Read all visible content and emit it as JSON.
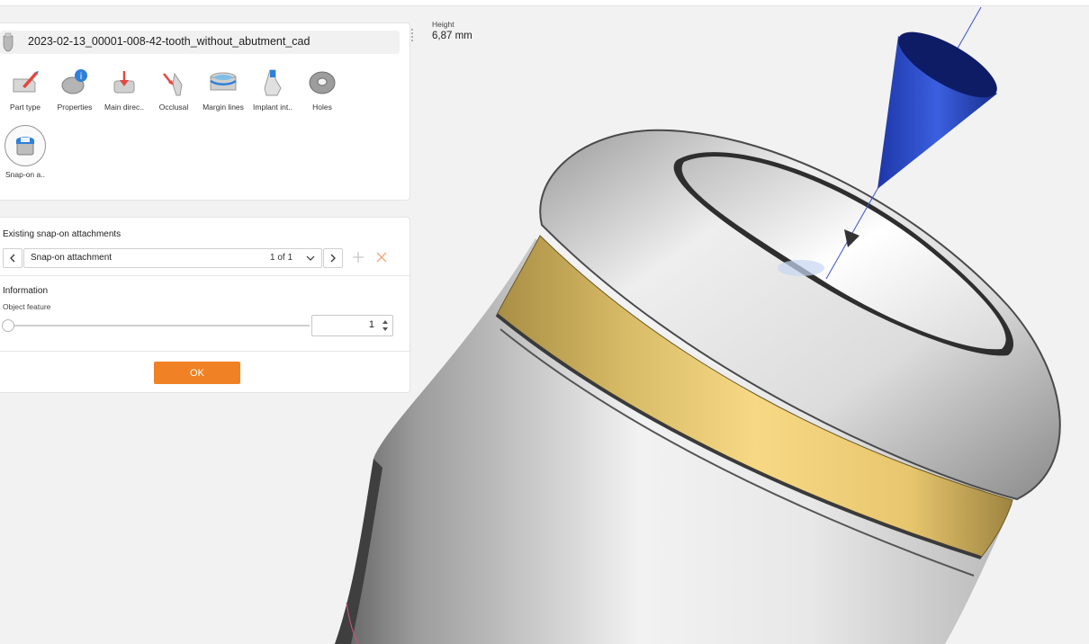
{
  "part": {
    "title": "2023-02-13_00001-008-42-tooth_without_abutment_cad"
  },
  "tools": [
    {
      "label": "Part type",
      "icon": "part-type-icon"
    },
    {
      "label": "Properties",
      "icon": "properties-icon"
    },
    {
      "label": "Main direc..",
      "icon": "main-direction-icon"
    },
    {
      "label": "Occlusal",
      "icon": "occlusal-icon"
    },
    {
      "label": "Margin lines",
      "icon": "margin-lines-icon"
    },
    {
      "label": "Implant int..",
      "icon": "implant-interface-icon"
    },
    {
      "label": "Holes",
      "icon": "holes-icon"
    },
    {
      "label": "Snap-on a..",
      "icon": "snap-on-attachment-icon",
      "active": true
    }
  ],
  "attachments": {
    "section_title": "Existing snap-on attachments",
    "selected": "Snap-on attachment",
    "count": "1 of 1"
  },
  "information": {
    "section_title": "Information",
    "feature_label": "Object feature",
    "feature_value": "1",
    "slider_fraction": 0
  },
  "ok_label": "OK",
  "measurement": {
    "label": "Height",
    "value": "6,87 mm"
  },
  "colors": {
    "accent": "#f08124",
    "cone": "#2f4fcf",
    "ring_band": "#f1cf72",
    "mesh": "#d8d8d8"
  }
}
